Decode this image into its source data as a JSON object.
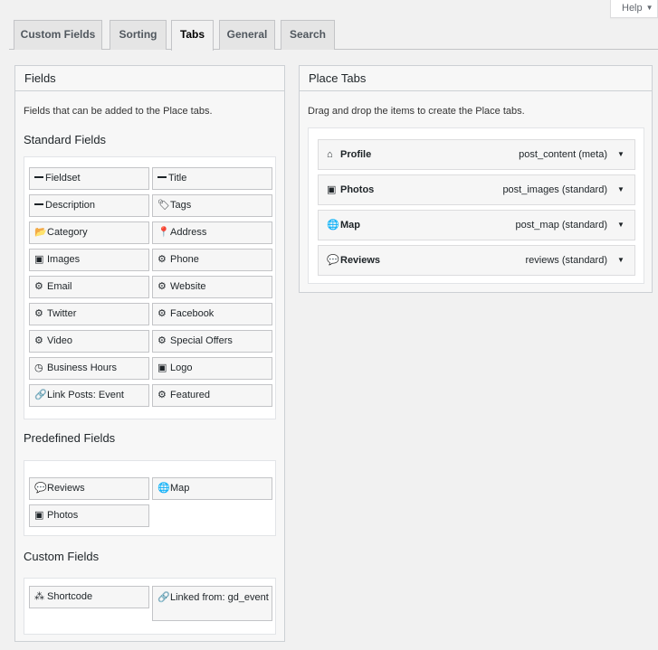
{
  "help": {
    "label": "Help"
  },
  "tabs": [
    {
      "label": "Custom Fields",
      "active": false
    },
    {
      "label": "Sorting",
      "active": false
    },
    {
      "label": "Tabs",
      "active": true
    },
    {
      "label": "General",
      "active": false
    },
    {
      "label": "Search",
      "active": false
    }
  ],
  "fields_panel": {
    "title": "Fields",
    "description": "Fields that can be added to the Place tabs.",
    "standard": {
      "title": "Standard Fields",
      "items": [
        {
          "label": "Fieldset",
          "icon": "minus-icon"
        },
        {
          "label": "Title",
          "icon": "minus-icon"
        },
        {
          "label": "Description",
          "icon": "minus-icon"
        },
        {
          "label": "Tags",
          "icon": "tags-icon"
        },
        {
          "label": "Category",
          "icon": "folder-open-icon"
        },
        {
          "label": "Address",
          "icon": "map-marker-icon"
        },
        {
          "label": "Images",
          "icon": "image-icon"
        },
        {
          "label": "Phone",
          "icon": "cog-icon"
        },
        {
          "label": "Email",
          "icon": "cog-icon"
        },
        {
          "label": "Website",
          "icon": "cog-icon"
        },
        {
          "label": "Twitter",
          "icon": "cog-icon"
        },
        {
          "label": "Facebook",
          "icon": "cog-icon"
        },
        {
          "label": "Video",
          "icon": "cog-icon"
        },
        {
          "label": "Special Offers",
          "icon": "cog-icon"
        },
        {
          "label": "Business Hours",
          "icon": "clock-icon"
        },
        {
          "label": "Logo",
          "icon": "image-icon"
        },
        {
          "label": "Link Posts: Event",
          "icon": "link-icon"
        },
        {
          "label": "Featured",
          "icon": "cog-icon"
        }
      ]
    },
    "predefined": {
      "title": "Predefined Fields",
      "items": [
        {
          "label": "Reviews",
          "icon": "comments-icon"
        },
        {
          "label": "Map",
          "icon": "globe-icon"
        },
        {
          "label": "Photos",
          "icon": "images-icon"
        }
      ]
    },
    "custom": {
      "title": "Custom Fields",
      "items": [
        {
          "label": "Shortcode",
          "icon": "cubes-icon"
        },
        {
          "label": "Linked from: gd_event",
          "icon": "link-icon"
        }
      ]
    }
  },
  "place_tabs_panel": {
    "title": "Place Tabs",
    "description": "Drag and drop the items to create the Place tabs.",
    "items": [
      {
        "label": "Profile",
        "meta": "post_content (meta)",
        "icon": "home-icon"
      },
      {
        "label": "Photos",
        "meta": "post_images (standard)",
        "icon": "images-icon"
      },
      {
        "label": "Map",
        "meta": "post_map (standard)",
        "icon": "globe-icon"
      },
      {
        "label": "Reviews",
        "meta": "reviews (standard)",
        "icon": "comments-icon"
      }
    ]
  }
}
